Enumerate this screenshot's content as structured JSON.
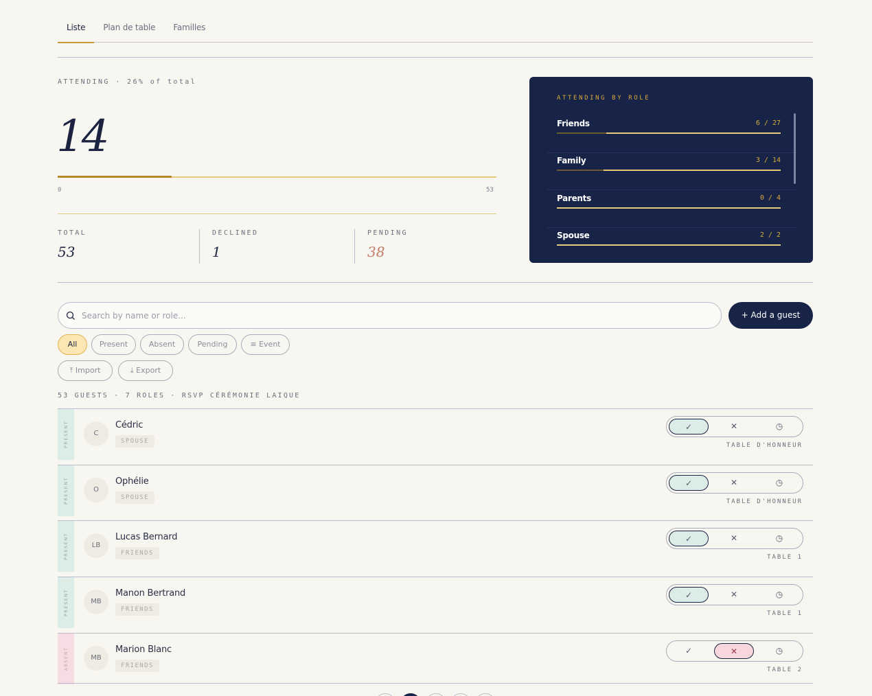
{
  "tabs": [
    {
      "label": "Liste"
    },
    {
      "label": "Plan de table"
    },
    {
      "label": "Familles"
    }
  ],
  "attending": {
    "label": "ATTENDING · 26% of total",
    "count": "14",
    "progress_fraction": 0.26,
    "min": "0",
    "max": "53"
  },
  "stats": {
    "total_label": "TOTAL",
    "total_value": "53",
    "declined_label": "DECLINED",
    "declined_value": "1",
    "pending_label": "PENDING",
    "pending_value": "38"
  },
  "role_card": {
    "title": "ATTENDING BY ROLE",
    "roles": [
      {
        "name": "Friends",
        "count": "6 / 27",
        "fraction": 0.22
      },
      {
        "name": "Family",
        "count": "3 / 14",
        "fraction": 0.21
      },
      {
        "name": "Parents",
        "count": "0 / 4",
        "fraction": 0
      },
      {
        "name": "Spouse",
        "count": "2 / 2",
        "fraction": 1
      }
    ]
  },
  "search": {
    "placeholder": "Search by name or role..."
  },
  "add_button": "+  Add a guest",
  "filters": [
    {
      "label": "All",
      "active": true
    },
    {
      "label": "Present"
    },
    {
      "label": "Absent"
    },
    {
      "label": "Pending"
    },
    {
      "label": "Event",
      "icon": "filter-icon"
    }
  ],
  "actions": [
    {
      "label": "Import",
      "icon": "upload-icon"
    },
    {
      "label": "Export",
      "icon": "download-icon"
    }
  ],
  "meta": "53 GUESTS · 7 ROLES · RSVP CÉRÉMONIE LAIQUE",
  "guests": [
    {
      "status": "PRESENT",
      "initials": "C",
      "name": "Cédric",
      "role": "SPOUSE",
      "rsvp": "yes",
      "table": "TABLE D'HONNEUR"
    },
    {
      "status": "PRESENT",
      "initials": "O",
      "name": "Ophélie",
      "role": "SPOUSE",
      "rsvp": "yes",
      "table": "TABLE D'HONNEUR"
    },
    {
      "status": "PRESENT",
      "initials": "LB",
      "name": "Lucas Bernard",
      "role": "FRIENDS",
      "rsvp": "yes",
      "table": "TABLE 1"
    },
    {
      "status": "PRESENT",
      "initials": "MB",
      "name": "Manon Bertrand",
      "role": "FRIENDS",
      "rsvp": "yes",
      "table": "TABLE 1"
    },
    {
      "status": "ABSENT",
      "initials": "MB",
      "name": "Marion Blanc",
      "role": "FRIENDS",
      "rsvp": "no",
      "table": "TABLE 2"
    }
  ],
  "rsvp_icons": [
    "check-icon",
    "close-icon",
    "clock-icon"
  ],
  "colors": {
    "navy": "#172447",
    "gold": "#d9a93b",
    "present": "#dcece6",
    "absent": "#f7dde3"
  }
}
